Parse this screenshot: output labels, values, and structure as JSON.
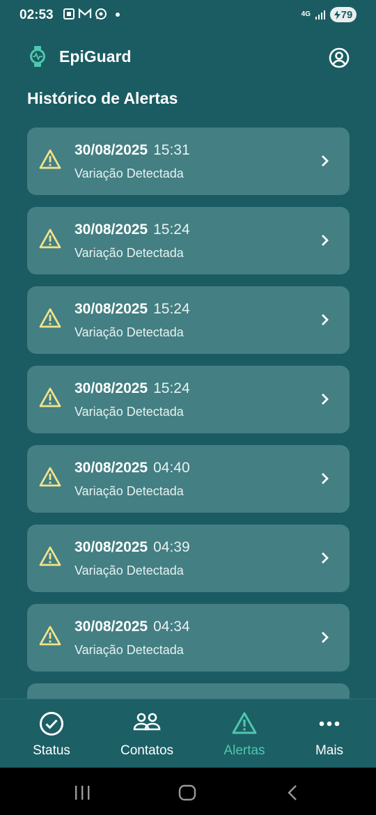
{
  "status_bar": {
    "time": "02:53",
    "network": "4G",
    "battery": "79"
  },
  "app": {
    "title": "EpiGuard"
  },
  "page_title": "Histórico de Alertas",
  "alerts": [
    {
      "date": "30/08/2025",
      "time": "15:31",
      "description": "Variação Detectada"
    },
    {
      "date": "30/08/2025",
      "time": "15:24",
      "description": "Variação Detectada"
    },
    {
      "date": "30/08/2025",
      "time": "15:24",
      "description": "Variação Detectada"
    },
    {
      "date": "30/08/2025",
      "time": "15:24",
      "description": "Variação Detectada"
    },
    {
      "date": "30/08/2025",
      "time": "04:40",
      "description": "Variação Detectada"
    },
    {
      "date": "30/08/2025",
      "time": "04:39",
      "description": "Variação Detectada"
    },
    {
      "date": "30/08/2025",
      "time": "04:34",
      "description": "Variação Detectada"
    }
  ],
  "bottom_nav": [
    {
      "label": "Status",
      "icon": "check-circle-icon",
      "active": false
    },
    {
      "label": "Contatos",
      "icon": "contacts-icon",
      "active": false
    },
    {
      "label": "Alertas",
      "icon": "warning-icon",
      "active": true
    },
    {
      "label": "Mais",
      "icon": "more-icon",
      "active": false
    }
  ],
  "colors": {
    "background": "#1a5c62",
    "card": "#437f83",
    "warning": "#f3e38b",
    "active": "#4fc7ad"
  }
}
